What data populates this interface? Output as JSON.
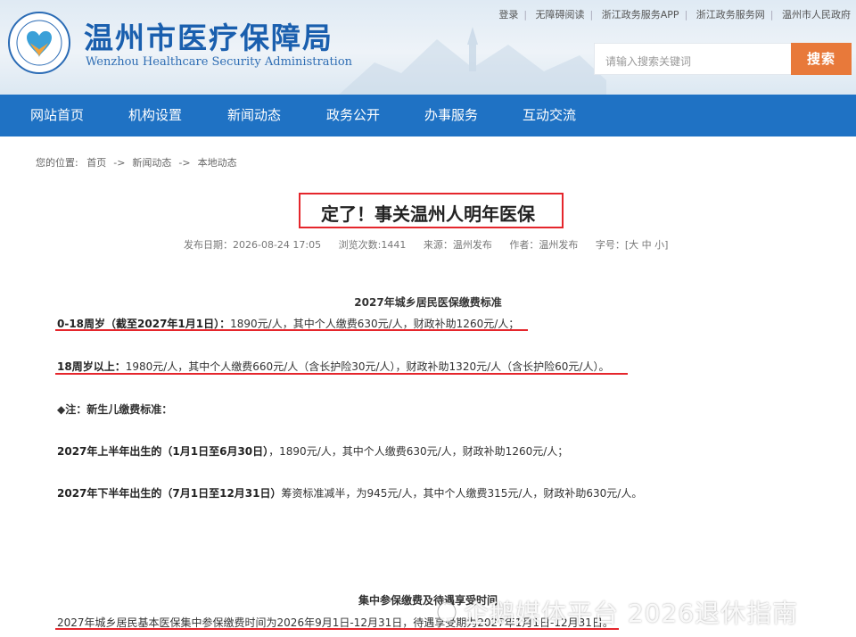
{
  "header": {
    "title": "温州市医疗保障局",
    "subtitle": "Wenzhou Healthcare Security Administration",
    "toplinks": [
      "登录",
      "无障碍阅读",
      "浙江政务服务APP",
      "浙江政务服务网",
      "温州市人民政府"
    ],
    "search_placeholder": "请输入搜索关键词",
    "search_button": "搜索"
  },
  "nav": [
    "网站首页",
    "机构设置",
    "新闻动态",
    "政务公开",
    "办事服务",
    "互动交流"
  ],
  "breadcrumb": {
    "label": "您的位置:",
    "items": [
      "首页",
      "新闻动态",
      "本地动态"
    ],
    "separator": "->"
  },
  "article": {
    "title": "定了！事关温州人明年医保",
    "meta": {
      "date": "发布日期：2026-08-24 17:05",
      "views": "浏览次数:1441",
      "source": "来源：温州发布",
      "author": "作者：温州发布",
      "font_label": "字号：",
      "font_sizes": "[大 中 小]"
    },
    "section1_title": "2027年城乡居民医保缴费标准",
    "p1_bold": "0-18周岁（截至2027年1月1日）：",
    "p1_text": "1890元/人，其中个人缴费630元/人，财政补助1260元/人；",
    "p2_bold": "18周岁以上：",
    "p2_text": "1980元/人，其中个人缴费660元/人（含长护险30元/人），财政补助1320元/人（含长护险60元/人）。",
    "note": "◆注：新生儿缴费标准：",
    "p3_bold": "2027年上半年出生的（1月1日至6月30日）",
    "p3_text": "，1890元/人，其中个人缴费630元/人，财政补助1260元/人；",
    "p4_bold": "2027年下半年出生的（7月1日至12月31日）",
    "p4_text": "筹资标准减半，为945元/人，其中个人缴费315元/人，财政补助630元/人。",
    "section2_title": "集中参保缴费及待遇享受时间",
    "p5_text": "2027年城乡居民基本医保集中参保缴费时间为2026年9月1日-12月31日，待遇享受期为2027年1月1日-12月31日。"
  },
  "watermark": "企鹅媒体平台 2026退休指南",
  "colors": {
    "brand_blue": "#1f72c4",
    "accent_red": "#e5262c",
    "search_orange": "#e8793a"
  }
}
